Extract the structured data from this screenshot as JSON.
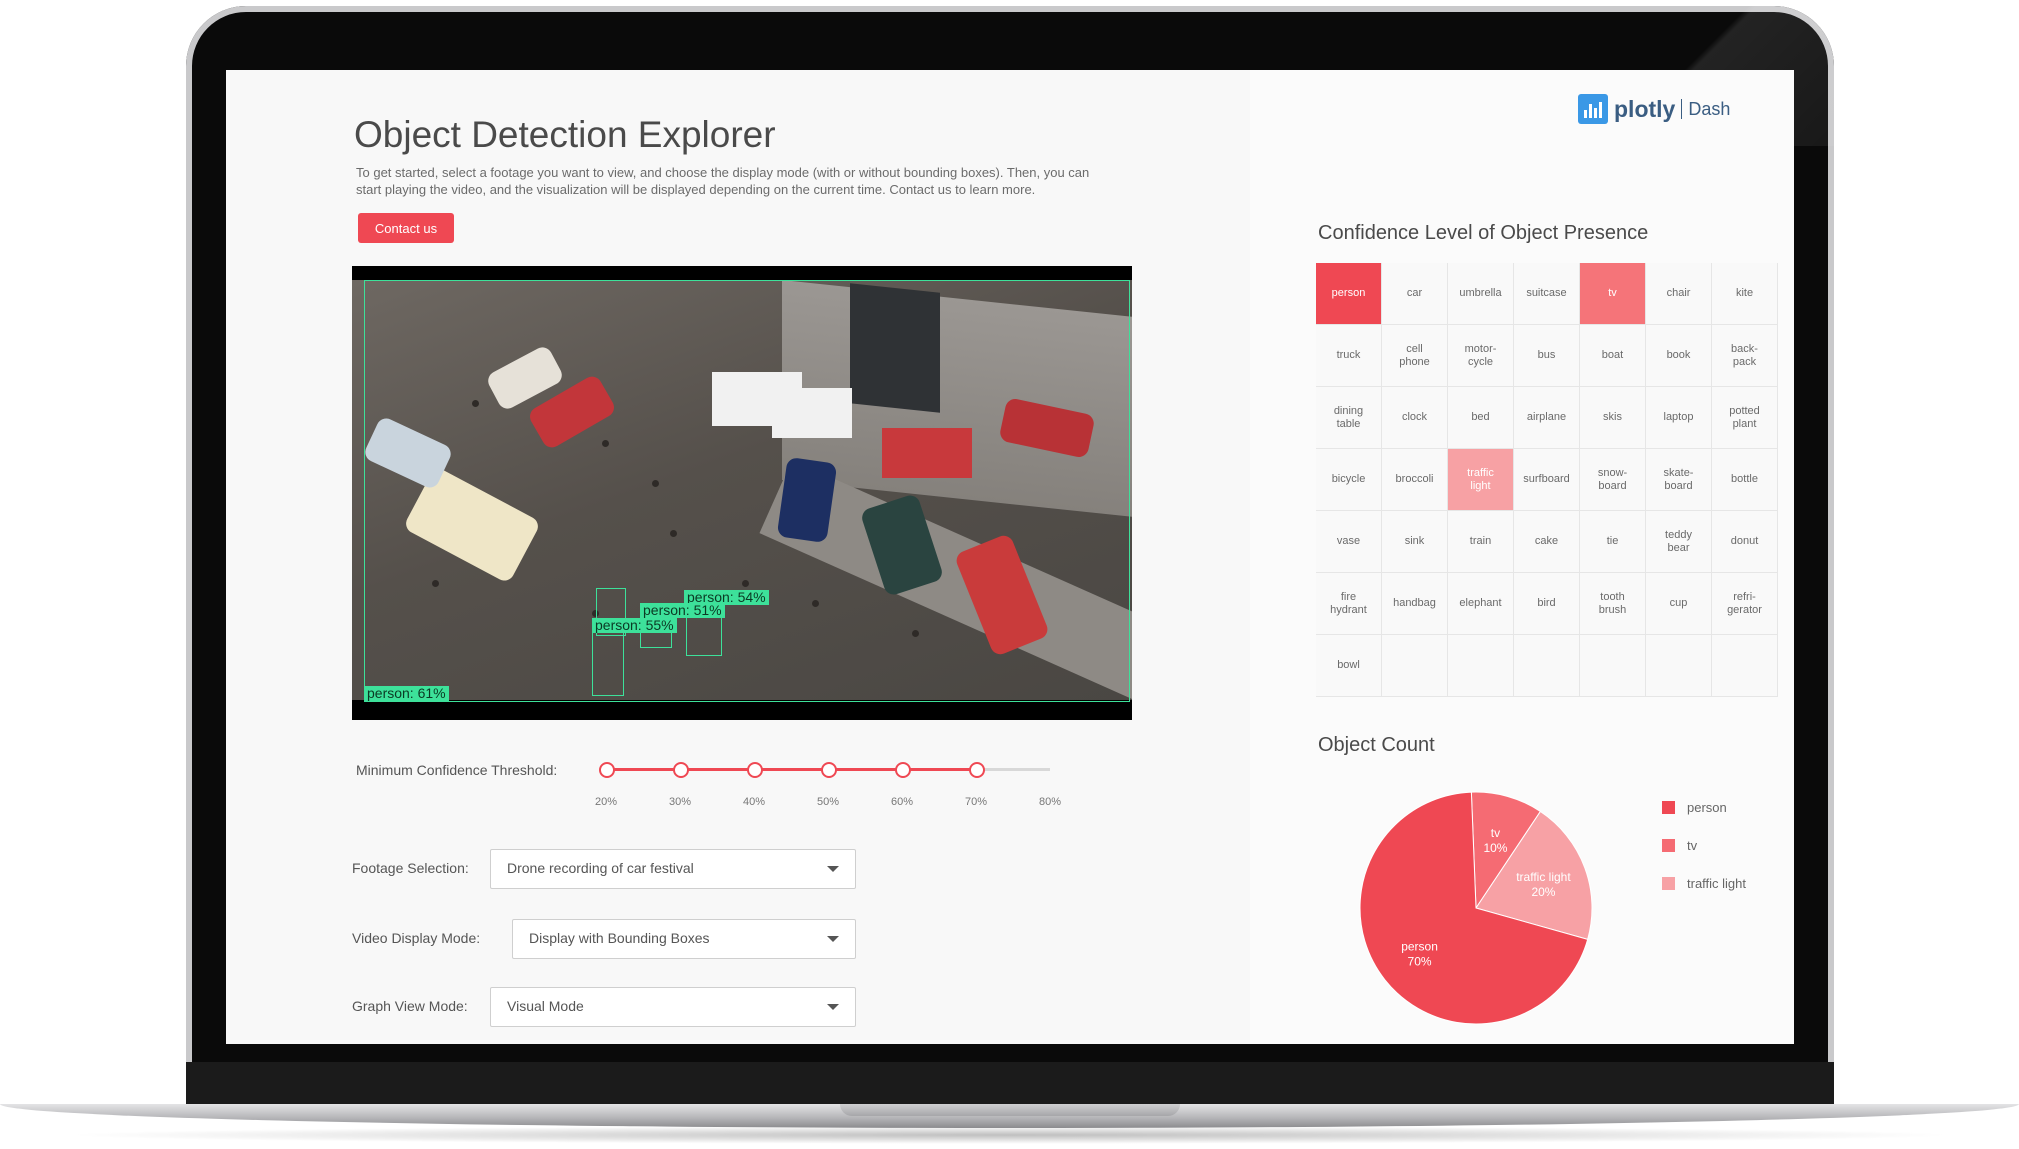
{
  "app": {
    "title": "Object Detection Explorer",
    "description": "To get started, select a footage you want to view, and choose the display mode (with or without bounding boxes). Then, you can start playing the video, and the visualization will be displayed depending on the current time. Contact us to learn more.",
    "contact_label": "Contact us"
  },
  "brand": {
    "name": "plotly",
    "product": "Dash",
    "color": "#3a98e6"
  },
  "video": {
    "detections": [
      "person: 54%",
      "person: 51%",
      "person: 55%",
      "person: 61%"
    ]
  },
  "slider": {
    "label": "Minimum Confidence Threshold:",
    "ticks": [
      "20%",
      "30%",
      "40%",
      "50%",
      "60%",
      "70%",
      "80%"
    ],
    "value": 0.7,
    "accent": "#ef4853"
  },
  "controls": {
    "footage": {
      "label": "Footage Selection:",
      "value": "Drone recording of car festival"
    },
    "display_mode": {
      "label": "Video Display Mode:",
      "value": "Display with Bounding Boxes"
    },
    "graph_mode": {
      "label": "Graph View Mode:",
      "value": "Visual Mode"
    }
  },
  "heatmap": {
    "title": "Confidence Level of Object Presence",
    "rows": [
      [
        "person",
        "car",
        "umbrella",
        "suitcase",
        "tv",
        "chair",
        "kite"
      ],
      [
        "truck",
        "cell\nphone",
        "motor-\ncycle",
        "bus",
        "boat",
        "book",
        "back-\npack"
      ],
      [
        "dining\ntable",
        "clock",
        "bed",
        "airplane",
        "skis",
        "laptop",
        "potted\nplant"
      ],
      [
        "bicycle",
        "broccoli",
        "traffic\nlight",
        "surfboard",
        "snow-\nboard",
        "skate-\nboard",
        "bottle"
      ],
      [
        "vase",
        "sink",
        "train",
        "cake",
        "tie",
        "teddy\nbear",
        "donut"
      ],
      [
        "fire\nhydrant",
        "handbag",
        "elephant",
        "bird",
        "tooth\nbrush",
        "cup",
        "refri-\ngerator"
      ],
      [
        "bowl",
        "",
        "",
        "",
        "",
        "",
        ""
      ]
    ],
    "highlights": [
      {
        "label": "person",
        "color": "#ef4853"
      },
      {
        "label": "tv",
        "color": "#f57479"
      },
      {
        "label": "traffic\nlight",
        "color": "#f7a1a4"
      }
    ]
  },
  "object_count": {
    "title": "Object Count",
    "legend": [
      {
        "name": "person",
        "color": "#ef4853"
      },
      {
        "name": "tv",
        "color": "#f56b73"
      },
      {
        "name": "traffic light",
        "color": "#f7a1a5"
      }
    ]
  },
  "chart_data": {
    "type": "pie",
    "title": "Object Count",
    "slices": [
      {
        "label": "person",
        "percent": 70,
        "color": "#ef4853"
      },
      {
        "label": "tv",
        "percent": 10,
        "color": "#f56b73"
      },
      {
        "label": "traffic light",
        "percent": 20,
        "color": "#f7a1a5"
      }
    ],
    "legend": "right"
  }
}
